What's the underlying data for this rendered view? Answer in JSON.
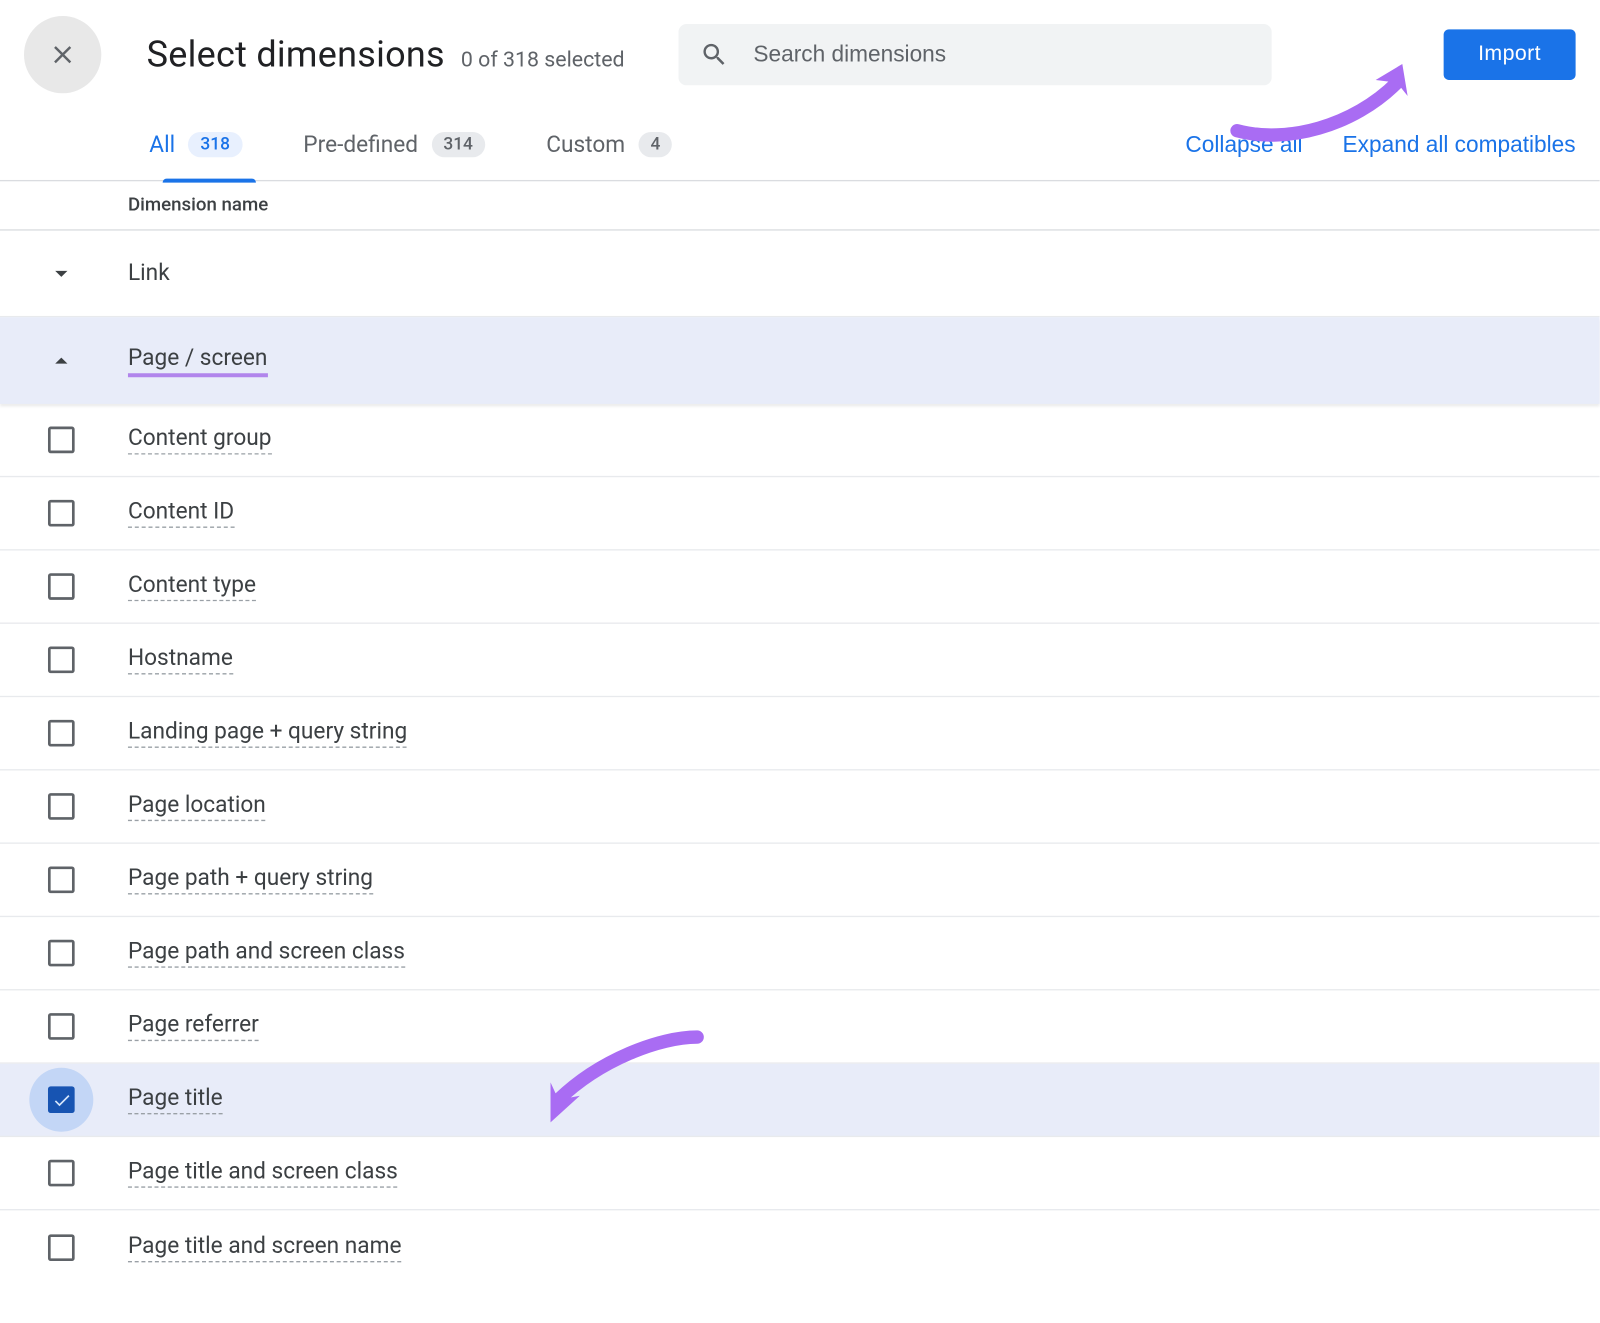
{
  "header": {
    "title": "Select dimensions",
    "subtitle": "0 of 318 selected",
    "search_placeholder": "Search dimensions",
    "import_label": "Import"
  },
  "tabs": {
    "all": {
      "label": "All",
      "count": "318"
    },
    "predefined": {
      "label": "Pre-defined",
      "count": "314"
    },
    "custom": {
      "label": "Custom",
      "count": "4"
    },
    "collapse": "Collapse all",
    "expand": "Expand all compatibles"
  },
  "column_header": "Dimension name",
  "groups": {
    "link": "Link",
    "page_screen": "Page / screen"
  },
  "items": [
    {
      "label": "Content group"
    },
    {
      "label": "Content ID"
    },
    {
      "label": "Content type"
    },
    {
      "label": "Hostname"
    },
    {
      "label": "Landing page + query string"
    },
    {
      "label": "Page location"
    },
    {
      "label": "Page path + query string"
    },
    {
      "label": "Page path and screen class"
    },
    {
      "label": "Page referrer"
    },
    {
      "label": "Page title",
      "selected": true
    },
    {
      "label": "Page title and screen class"
    },
    {
      "label": "Page title and screen name"
    }
  ]
}
